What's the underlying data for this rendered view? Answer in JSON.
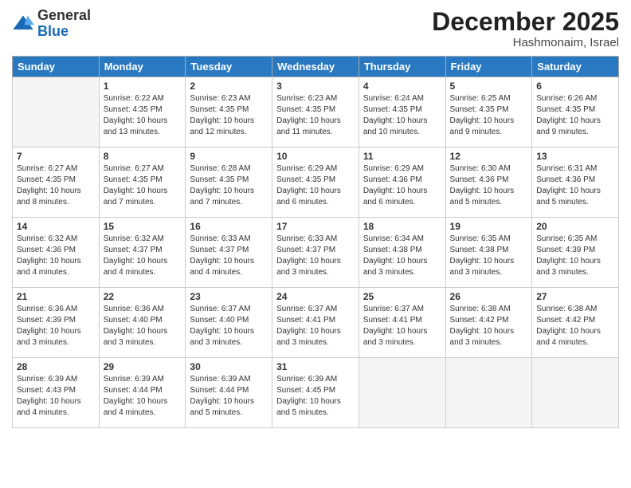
{
  "header": {
    "logo_general": "General",
    "logo_blue": "Blue",
    "month_title": "December 2025",
    "location": "Hashmonaim, Israel"
  },
  "days_of_week": [
    "Sunday",
    "Monday",
    "Tuesday",
    "Wednesday",
    "Thursday",
    "Friday",
    "Saturday"
  ],
  "weeks": [
    [
      {
        "day": "",
        "info": ""
      },
      {
        "day": "1",
        "info": "Sunrise: 6:22 AM\nSunset: 4:35 PM\nDaylight: 10 hours\nand 13 minutes."
      },
      {
        "day": "2",
        "info": "Sunrise: 6:23 AM\nSunset: 4:35 PM\nDaylight: 10 hours\nand 12 minutes."
      },
      {
        "day": "3",
        "info": "Sunrise: 6:23 AM\nSunset: 4:35 PM\nDaylight: 10 hours\nand 11 minutes."
      },
      {
        "day": "4",
        "info": "Sunrise: 6:24 AM\nSunset: 4:35 PM\nDaylight: 10 hours\nand 10 minutes."
      },
      {
        "day": "5",
        "info": "Sunrise: 6:25 AM\nSunset: 4:35 PM\nDaylight: 10 hours\nand 9 minutes."
      },
      {
        "day": "6",
        "info": "Sunrise: 6:26 AM\nSunset: 4:35 PM\nDaylight: 10 hours\nand 9 minutes."
      }
    ],
    [
      {
        "day": "7",
        "info": "Sunrise: 6:27 AM\nSunset: 4:35 PM\nDaylight: 10 hours\nand 8 minutes."
      },
      {
        "day": "8",
        "info": "Sunrise: 6:27 AM\nSunset: 4:35 PM\nDaylight: 10 hours\nand 7 minutes."
      },
      {
        "day": "9",
        "info": "Sunrise: 6:28 AM\nSunset: 4:35 PM\nDaylight: 10 hours\nand 7 minutes."
      },
      {
        "day": "10",
        "info": "Sunrise: 6:29 AM\nSunset: 4:35 PM\nDaylight: 10 hours\nand 6 minutes."
      },
      {
        "day": "11",
        "info": "Sunrise: 6:29 AM\nSunset: 4:36 PM\nDaylight: 10 hours\nand 6 minutes."
      },
      {
        "day": "12",
        "info": "Sunrise: 6:30 AM\nSunset: 4:36 PM\nDaylight: 10 hours\nand 5 minutes."
      },
      {
        "day": "13",
        "info": "Sunrise: 6:31 AM\nSunset: 4:36 PM\nDaylight: 10 hours\nand 5 minutes."
      }
    ],
    [
      {
        "day": "14",
        "info": "Sunrise: 6:32 AM\nSunset: 4:36 PM\nDaylight: 10 hours\nand 4 minutes."
      },
      {
        "day": "15",
        "info": "Sunrise: 6:32 AM\nSunset: 4:37 PM\nDaylight: 10 hours\nand 4 minutes."
      },
      {
        "day": "16",
        "info": "Sunrise: 6:33 AM\nSunset: 4:37 PM\nDaylight: 10 hours\nand 4 minutes."
      },
      {
        "day": "17",
        "info": "Sunrise: 6:33 AM\nSunset: 4:37 PM\nDaylight: 10 hours\nand 3 minutes."
      },
      {
        "day": "18",
        "info": "Sunrise: 6:34 AM\nSunset: 4:38 PM\nDaylight: 10 hours\nand 3 minutes."
      },
      {
        "day": "19",
        "info": "Sunrise: 6:35 AM\nSunset: 4:38 PM\nDaylight: 10 hours\nand 3 minutes."
      },
      {
        "day": "20",
        "info": "Sunrise: 6:35 AM\nSunset: 4:39 PM\nDaylight: 10 hours\nand 3 minutes."
      }
    ],
    [
      {
        "day": "21",
        "info": "Sunrise: 6:36 AM\nSunset: 4:39 PM\nDaylight: 10 hours\nand 3 minutes."
      },
      {
        "day": "22",
        "info": "Sunrise: 6:36 AM\nSunset: 4:40 PM\nDaylight: 10 hours\nand 3 minutes."
      },
      {
        "day": "23",
        "info": "Sunrise: 6:37 AM\nSunset: 4:40 PM\nDaylight: 10 hours\nand 3 minutes."
      },
      {
        "day": "24",
        "info": "Sunrise: 6:37 AM\nSunset: 4:41 PM\nDaylight: 10 hours\nand 3 minutes."
      },
      {
        "day": "25",
        "info": "Sunrise: 6:37 AM\nSunset: 4:41 PM\nDaylight: 10 hours\nand 3 minutes."
      },
      {
        "day": "26",
        "info": "Sunrise: 6:38 AM\nSunset: 4:42 PM\nDaylight: 10 hours\nand 3 minutes."
      },
      {
        "day": "27",
        "info": "Sunrise: 6:38 AM\nSunset: 4:42 PM\nDaylight: 10 hours\nand 4 minutes."
      }
    ],
    [
      {
        "day": "28",
        "info": "Sunrise: 6:39 AM\nSunset: 4:43 PM\nDaylight: 10 hours\nand 4 minutes."
      },
      {
        "day": "29",
        "info": "Sunrise: 6:39 AM\nSunset: 4:44 PM\nDaylight: 10 hours\nand 4 minutes."
      },
      {
        "day": "30",
        "info": "Sunrise: 6:39 AM\nSunset: 4:44 PM\nDaylight: 10 hours\nand 5 minutes."
      },
      {
        "day": "31",
        "info": "Sunrise: 6:39 AM\nSunset: 4:45 PM\nDaylight: 10 hours\nand 5 minutes."
      },
      {
        "day": "",
        "info": ""
      },
      {
        "day": "",
        "info": ""
      },
      {
        "day": "",
        "info": ""
      }
    ]
  ]
}
